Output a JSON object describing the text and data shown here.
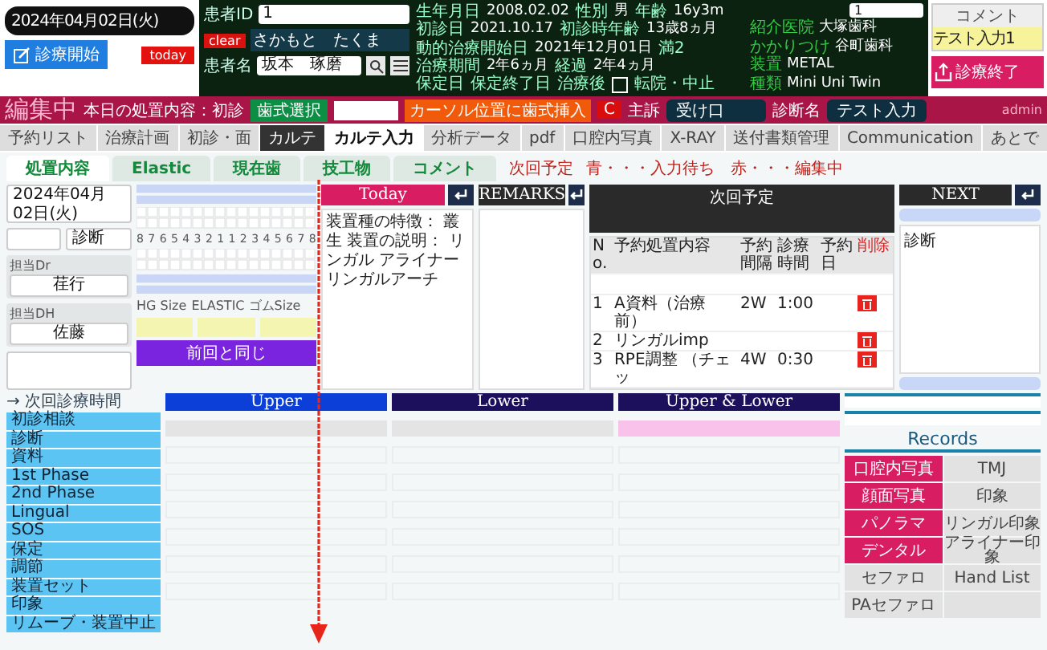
{
  "header": {
    "date": "2024年04月02日(火)",
    "start_button": "診療開始",
    "today_button": "today"
  },
  "patient": {
    "id_label": "患者ID",
    "id": "1",
    "clear_button": "clear",
    "kana": "さかもと　たくま",
    "name_label": "患者名",
    "name": "坂本　琢磨",
    "info_rows": [
      [
        {
          "label": "生年月日",
          "value": "2008.02.02"
        },
        {
          "label": "性別",
          "value": "男"
        },
        {
          "label": "年齢",
          "value": "16y3m"
        }
      ],
      [
        {
          "label": "初診日",
          "value": "2021.10.17"
        },
        {
          "label": "初診時年齢",
          "value": "13歳8ヵ月"
        }
      ],
      [
        {
          "label": "動的治療開始日",
          "value": "2021年12月01日"
        },
        {
          "label": "満2"
        }
      ],
      [
        {
          "label": "治療期間",
          "value": "2年6ヵ月"
        },
        {
          "label": "経過",
          "value": "2年4ヵ月"
        }
      ],
      [
        {
          "label": "保定日"
        },
        {
          "label": "保定終了日"
        },
        {
          "label": "治療後"
        }
      ]
    ],
    "transfer": {
      "label": "転院・中止",
      "checked": false
    },
    "side_field": "1",
    "side_info": [
      {
        "label": "紹介医院",
        "value": "大塚歯科"
      },
      {
        "label": "かかりつけ",
        "value": "谷町歯科"
      },
      {
        "label": "装置",
        "value": "METAL"
      },
      {
        "label": "種類",
        "value": "Mini Uni Twin"
      }
    ]
  },
  "comment": {
    "label": "コメント",
    "value": "テスト入力1"
  },
  "end_button": "診療終了",
  "edit_bar": {
    "status": "編集中",
    "today_treatment": "本日の処置内容：初診",
    "tooth_select": "歯式選択",
    "insert_button": "カーソル位置に歯式挿入",
    "c_button": "C",
    "complaint_label": "主訴",
    "complaint": "受け口",
    "diagnosis_label": "診断名",
    "diagnosis": "テスト入力",
    "user": "admin"
  },
  "tabs": [
    {
      "label": "予約リスト",
      "selected": false,
      "dark": false
    },
    {
      "label": "治療計画",
      "selected": false,
      "dark": false
    },
    {
      "label": "初診・面",
      "selected": false,
      "dark": false
    },
    {
      "label": "カルテ",
      "selected": false,
      "dark": true
    },
    {
      "label": "カルテ入力",
      "selected": true,
      "dark": false
    },
    {
      "label": "分析データ",
      "selected": false,
      "dark": false
    },
    {
      "label": "pdf",
      "selected": false,
      "dark": false
    },
    {
      "label": "口腔内写真",
      "selected": false,
      "dark": false
    },
    {
      "label": "X-RAY",
      "selected": false,
      "dark": false
    },
    {
      "label": "送付書類管理",
      "selected": false,
      "dark": false
    },
    {
      "label": "Communication",
      "selected": false,
      "dark": false
    },
    {
      "label": "あとで",
      "selected": false,
      "dark": false
    }
  ],
  "sub_tabs": [
    {
      "label": "処置内容",
      "selected": true
    },
    {
      "label": "Elastic",
      "selected": false
    },
    {
      "label": "現在歯",
      "selected": false
    },
    {
      "label": "技工物",
      "selected": false
    },
    {
      "label": "コメント",
      "selected": false
    }
  ],
  "legend": {
    "title": "次回予定",
    "text": "青・・・入力待ち　赤・・・編集中"
  },
  "treatment": {
    "date": "2024年04月02日(火)",
    "diagnosis_field": "診断",
    "dr_label": "担当Dr",
    "dr": "荏行",
    "dh_label": "担当DH",
    "dh": "佐藤"
  },
  "tooth_chart": {
    "numbers": [
      "8",
      "7",
      "6",
      "5",
      "4",
      "3",
      "2",
      "1",
      "1",
      "2",
      "3",
      "4",
      "5",
      "6",
      "7",
      "8"
    ],
    "hg_label": "HG Size",
    "elastic_label": "ELASTIC ゴムSize",
    "same_button": "前回と同じ"
  },
  "today": {
    "title": "Today",
    "note_lines": [
      "装置種の特徴： 叢生 装置の説明： リンガル アライナー",
      "リンガルアーチ"
    ]
  },
  "remarks": {
    "title": "REMARKS"
  },
  "next_plan": {
    "title": "次回予定",
    "columns": [
      "No.",
      "予約処置内容",
      "予約間隔",
      "診療時間",
      "予約日",
      "削除"
    ],
    "rows": [
      {
        "no": "1",
        "content": "A資料（治療前）",
        "interval": "2W",
        "time": "1:00"
      },
      {
        "no": "2",
        "content": "リンガルimp"
      },
      {
        "no": "3",
        "content": "RPE調整 （チェッ",
        "interval": "4W",
        "time": "0:30"
      }
    ]
  },
  "next": {
    "title": "NEXT",
    "items": [
      "診断"
    ]
  },
  "visit_time_label": "→ 次回診療時間",
  "categories": [
    "初診相談",
    "診断",
    "資料",
    "1st Phase",
    "2nd Phase",
    "Lingual",
    "SOS",
    "保定",
    "調節",
    "装置セット",
    "印象",
    "リムーブ・装置中止"
  ],
  "arch_columns": [
    {
      "label": "Upper",
      "color": "#0b3fd8",
      "highlighted": false
    },
    {
      "label": "Lower",
      "color": "#1c0f5c",
      "highlighted": false
    },
    {
      "label": "Upper & Lower",
      "color": "#1c0f5c",
      "highlighted": true
    }
  ],
  "records": {
    "title": "Records",
    "buttons": [
      {
        "label": "口腔内写真",
        "on": true
      },
      {
        "label": "TMJ",
        "on": false
      },
      {
        "label": "顔面写真",
        "on": true
      },
      {
        "label": "印象",
        "on": false
      },
      {
        "label": "パノラマ",
        "on": true
      },
      {
        "label": "リンガル印象",
        "on": false
      },
      {
        "label": "デンタル",
        "on": true
      },
      {
        "label": "アライナー印象",
        "on": false
      },
      {
        "label": "セファロ",
        "on": false
      },
      {
        "label": "Hand List",
        "on": false
      },
      {
        "label": "PAセファロ",
        "on": false
      }
    ]
  }
}
